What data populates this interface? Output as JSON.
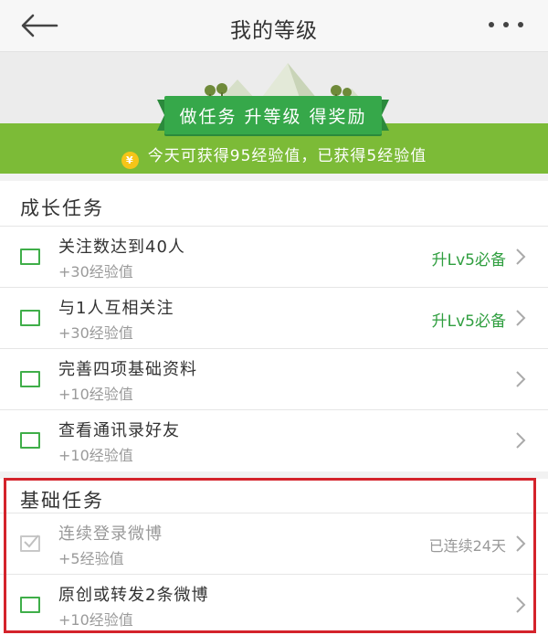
{
  "header": {
    "title": "我的等级",
    "back_icon": "back-arrow-icon",
    "more_icon": "more-dots-icon"
  },
  "banner": {
    "ribbon_text": "做任务 升等级 得奖励",
    "exp_text": "今天可获得95经验值，已获得5经验值",
    "coin_symbol": "¥",
    "colors": {
      "green": "#7cbb37",
      "ribbon": "#36a84a"
    }
  },
  "growth_tasks": {
    "title": "成长任务",
    "items": [
      {
        "title": "关注数达到40人",
        "exp": "+30经验值",
        "badge": "升Lv5必备"
      },
      {
        "title": "与1人互相关注",
        "exp": "+30经验值",
        "badge": "升Lv5必备"
      },
      {
        "title": "完善四项基础资料",
        "exp": "+10经验值",
        "badge": ""
      },
      {
        "title": "查看通讯录好友",
        "exp": "+10经验值",
        "badge": ""
      }
    ]
  },
  "basic_tasks": {
    "title": "基础任务",
    "items": [
      {
        "title": "连续登录微博",
        "exp": "+5经验值",
        "status": "已连续24天",
        "done": true
      },
      {
        "title": "原创或转发2条微博",
        "exp": "+10经验值",
        "status": "",
        "done": false
      }
    ]
  },
  "highlight_color": "#d4232b"
}
